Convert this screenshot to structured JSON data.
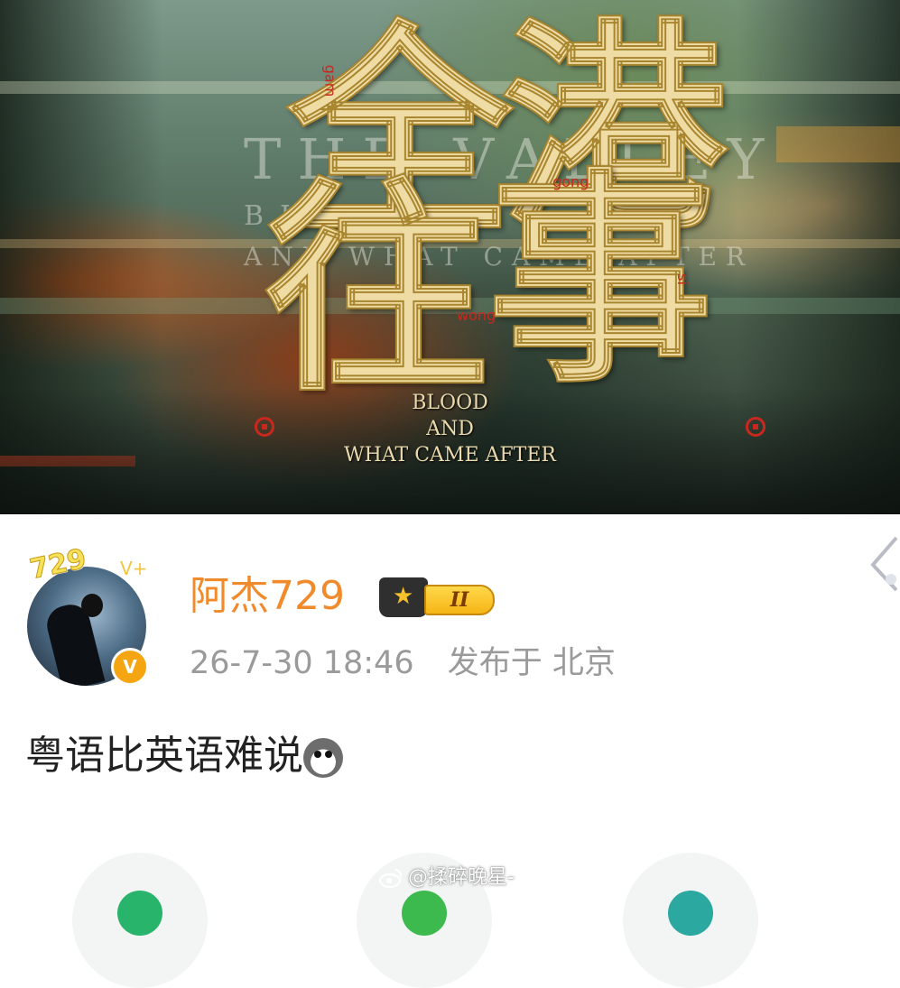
{
  "banner": {
    "title_char_1": "全",
    "title_char_2": "港",
    "title_char_3": "往",
    "title_char_4": "事",
    "romanization": [
      "gam",
      "gong",
      "wong",
      "si"
    ],
    "ghost_title": "THE VALLEY",
    "ghost_subtitle_1": "BLOOD",
    "ghost_subtitle_2": "AND WHAT CAME AFTER",
    "subtitle_line_1": "BLOOD",
    "subtitle_line_2": "AND",
    "subtitle_line_3": "WHAT CAME AFTER"
  },
  "post": {
    "avatar_frame_text": "729",
    "avatar_frame_level": "V+",
    "verified_badge": "V",
    "username": "阿杰729",
    "member_level": "II",
    "timestamp": "26-7-30 18:46",
    "location": "发布于 北京",
    "text": "粤语比英语难说",
    "emoji": "husky-emoji"
  },
  "watermark": {
    "text": "@揉碎晚星-"
  },
  "colors": {
    "username": "#f08a2a",
    "meta": "#9a9a9a",
    "title_gold": "#efdca4",
    "romanization_red": "#c8281e",
    "verified_orange": "#f6a512"
  }
}
